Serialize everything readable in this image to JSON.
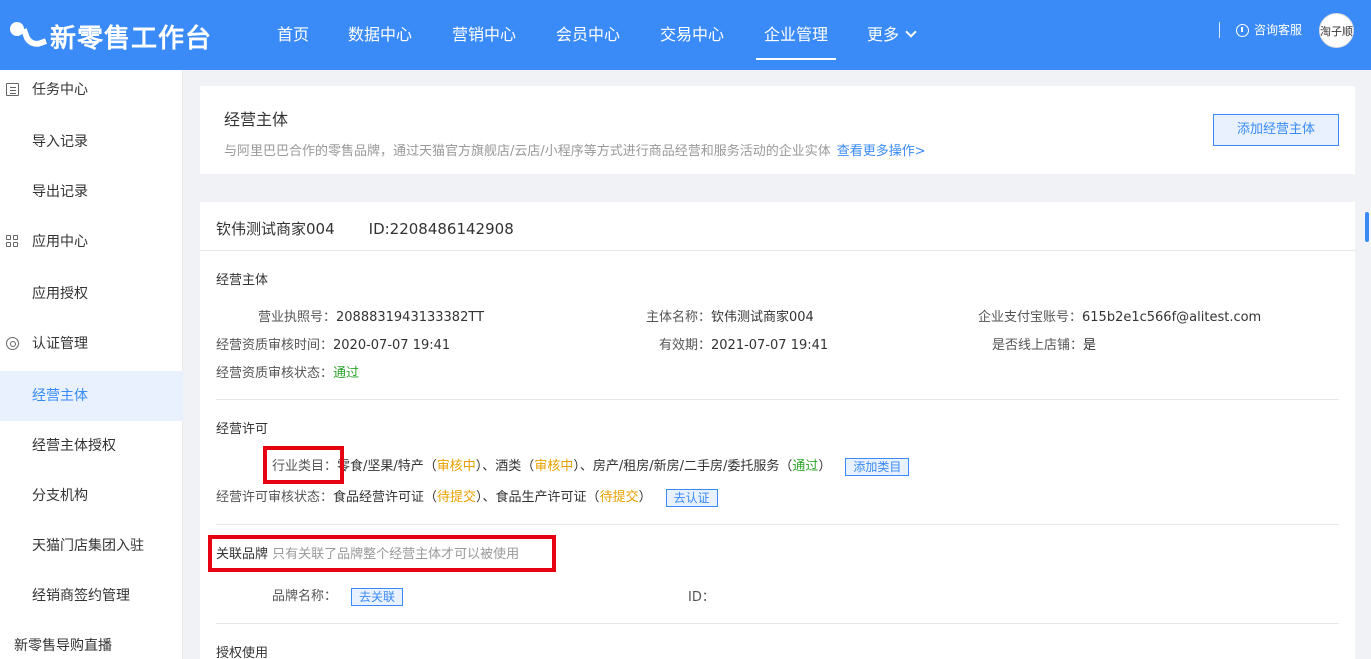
{
  "app": {
    "title": "新零售工作台"
  },
  "nav": {
    "items": [
      "首页",
      "数据中心",
      "营销中心",
      "会员中心",
      "交易中心",
      "企业管理",
      "更多"
    ],
    "consult": "咨询客服",
    "avatar": "淘子顺"
  },
  "sidebar": {
    "items": [
      "任务中心",
      "导入记录",
      "导出记录",
      "应用中心",
      "应用授权",
      "认证管理",
      "经营主体",
      "经营主体授权",
      "分支机构",
      "天猫门店集团入驻",
      "经销商签约管理",
      "新零售导购直播"
    ]
  },
  "header": {
    "title": "经营主体",
    "desc": "与阿里巴巴合作的零售品牌，通过天猫官方旗舰店/云店/小程序等方式进行商品经营和服务活动的企业实体",
    "more_link": "查看更多操作>",
    "add_button": "添加经营主体"
  },
  "merchant": {
    "name": "钦伟测试商家004",
    "id": "ID:2208486142908"
  },
  "entity": {
    "title": "经营主体",
    "license_no_label": "营业执照号：",
    "license_no": "2088831943133382TT",
    "entity_name_label": "主体名称：",
    "entity_name": "钦伟测试商家004",
    "alipay_label": "企业支付宝账号：",
    "alipay": "615b2e1c566f@alitest.com",
    "review_time_label": "经营资质审核时间：",
    "review_time": "2020-07-07 19:41",
    "valid_label": "有效期：",
    "valid": "2021-07-07 19:41",
    "online_label": "是否线上店铺：",
    "online": "是",
    "status_label": "经营资质审核状态：",
    "status": "通过"
  },
  "permit": {
    "title": "经营许可",
    "category_label": "行业类目：",
    "cat1": "零食/坚果/特产（",
    "cat1_status": "审核中",
    "cat2": "）、酒类（",
    "cat2_status": "审核中",
    "cat3": "）、房产/租房/新房/二手房/委托服务（",
    "cat3_status": "通过",
    "cat_end": "）",
    "add_category": "添加类目",
    "permit_status_label": "经营许可审核状态：",
    "p1": "食品经营许可证（",
    "p1_status": "待提交",
    "p2": "）、食品生产许可证（",
    "p2_status": "待提交",
    "p_end": "）",
    "certify": "去认证"
  },
  "brand": {
    "title": "关联品牌",
    "hint": "只有关联了品牌整个经营主体才可以被使用",
    "name_label": "品牌名称：",
    "link": "去关联",
    "id_label": "ID："
  },
  "auth": {
    "title": "授权使用"
  },
  "colors": {
    "primary": "#3a8bf7",
    "highlight": "#e60012",
    "success": "#2aa52a",
    "warning": "#e8a000"
  }
}
